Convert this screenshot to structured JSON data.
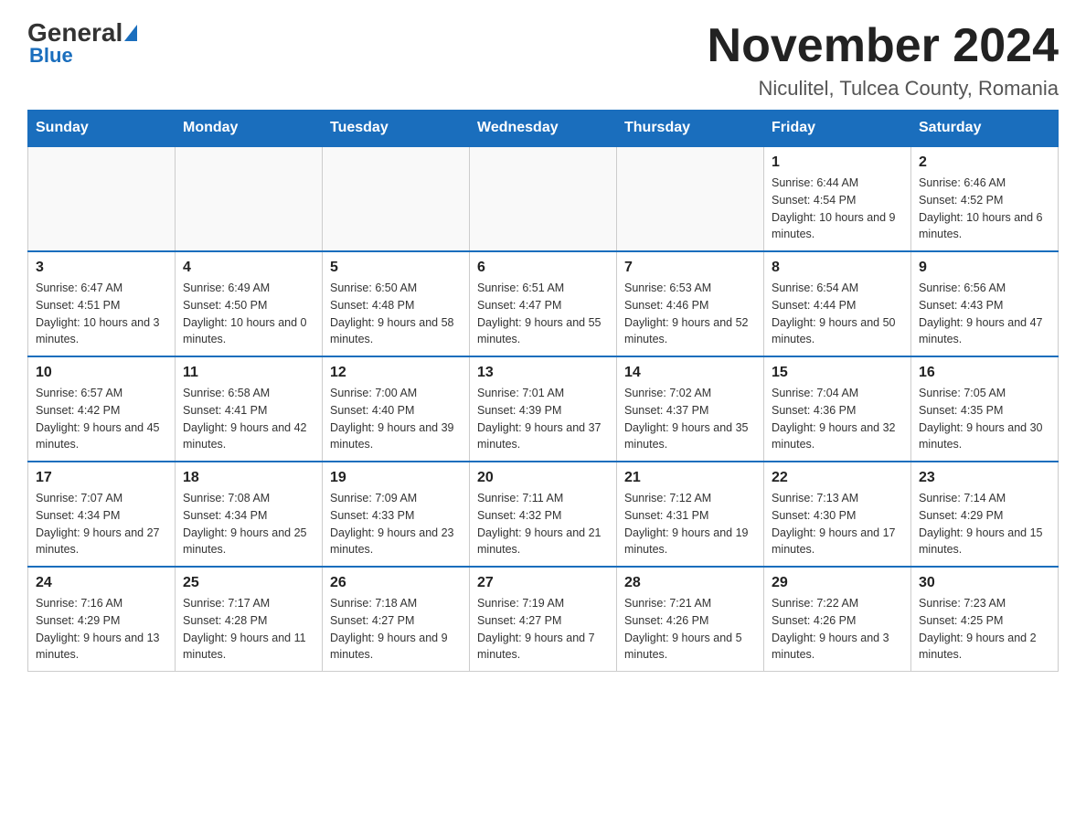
{
  "logo": {
    "general": "General",
    "blue": "Blue",
    "arrow": "▶"
  },
  "header": {
    "title": "November 2024",
    "subtitle": "Niculitel, Tulcea County, Romania"
  },
  "days_of_week": [
    "Sunday",
    "Monday",
    "Tuesday",
    "Wednesday",
    "Thursday",
    "Friday",
    "Saturday"
  ],
  "weeks": [
    [
      {
        "day": "",
        "info": ""
      },
      {
        "day": "",
        "info": ""
      },
      {
        "day": "",
        "info": ""
      },
      {
        "day": "",
        "info": ""
      },
      {
        "day": "",
        "info": ""
      },
      {
        "day": "1",
        "info": "Sunrise: 6:44 AM\nSunset: 4:54 PM\nDaylight: 10 hours and 9 minutes."
      },
      {
        "day": "2",
        "info": "Sunrise: 6:46 AM\nSunset: 4:52 PM\nDaylight: 10 hours and 6 minutes."
      }
    ],
    [
      {
        "day": "3",
        "info": "Sunrise: 6:47 AM\nSunset: 4:51 PM\nDaylight: 10 hours and 3 minutes."
      },
      {
        "day": "4",
        "info": "Sunrise: 6:49 AM\nSunset: 4:50 PM\nDaylight: 10 hours and 0 minutes."
      },
      {
        "day": "5",
        "info": "Sunrise: 6:50 AM\nSunset: 4:48 PM\nDaylight: 9 hours and 58 minutes."
      },
      {
        "day": "6",
        "info": "Sunrise: 6:51 AM\nSunset: 4:47 PM\nDaylight: 9 hours and 55 minutes."
      },
      {
        "day": "7",
        "info": "Sunrise: 6:53 AM\nSunset: 4:46 PM\nDaylight: 9 hours and 52 minutes."
      },
      {
        "day": "8",
        "info": "Sunrise: 6:54 AM\nSunset: 4:44 PM\nDaylight: 9 hours and 50 minutes."
      },
      {
        "day": "9",
        "info": "Sunrise: 6:56 AM\nSunset: 4:43 PM\nDaylight: 9 hours and 47 minutes."
      }
    ],
    [
      {
        "day": "10",
        "info": "Sunrise: 6:57 AM\nSunset: 4:42 PM\nDaylight: 9 hours and 45 minutes."
      },
      {
        "day": "11",
        "info": "Sunrise: 6:58 AM\nSunset: 4:41 PM\nDaylight: 9 hours and 42 minutes."
      },
      {
        "day": "12",
        "info": "Sunrise: 7:00 AM\nSunset: 4:40 PM\nDaylight: 9 hours and 39 minutes."
      },
      {
        "day": "13",
        "info": "Sunrise: 7:01 AM\nSunset: 4:39 PM\nDaylight: 9 hours and 37 minutes."
      },
      {
        "day": "14",
        "info": "Sunrise: 7:02 AM\nSunset: 4:37 PM\nDaylight: 9 hours and 35 minutes."
      },
      {
        "day": "15",
        "info": "Sunrise: 7:04 AM\nSunset: 4:36 PM\nDaylight: 9 hours and 32 minutes."
      },
      {
        "day": "16",
        "info": "Sunrise: 7:05 AM\nSunset: 4:35 PM\nDaylight: 9 hours and 30 minutes."
      }
    ],
    [
      {
        "day": "17",
        "info": "Sunrise: 7:07 AM\nSunset: 4:34 PM\nDaylight: 9 hours and 27 minutes."
      },
      {
        "day": "18",
        "info": "Sunrise: 7:08 AM\nSunset: 4:34 PM\nDaylight: 9 hours and 25 minutes."
      },
      {
        "day": "19",
        "info": "Sunrise: 7:09 AM\nSunset: 4:33 PM\nDaylight: 9 hours and 23 minutes."
      },
      {
        "day": "20",
        "info": "Sunrise: 7:11 AM\nSunset: 4:32 PM\nDaylight: 9 hours and 21 minutes."
      },
      {
        "day": "21",
        "info": "Sunrise: 7:12 AM\nSunset: 4:31 PM\nDaylight: 9 hours and 19 minutes."
      },
      {
        "day": "22",
        "info": "Sunrise: 7:13 AM\nSunset: 4:30 PM\nDaylight: 9 hours and 17 minutes."
      },
      {
        "day": "23",
        "info": "Sunrise: 7:14 AM\nSunset: 4:29 PM\nDaylight: 9 hours and 15 minutes."
      }
    ],
    [
      {
        "day": "24",
        "info": "Sunrise: 7:16 AM\nSunset: 4:29 PM\nDaylight: 9 hours and 13 minutes."
      },
      {
        "day": "25",
        "info": "Sunrise: 7:17 AM\nSunset: 4:28 PM\nDaylight: 9 hours and 11 minutes."
      },
      {
        "day": "26",
        "info": "Sunrise: 7:18 AM\nSunset: 4:27 PM\nDaylight: 9 hours and 9 minutes."
      },
      {
        "day": "27",
        "info": "Sunrise: 7:19 AM\nSunset: 4:27 PM\nDaylight: 9 hours and 7 minutes."
      },
      {
        "day": "28",
        "info": "Sunrise: 7:21 AM\nSunset: 4:26 PM\nDaylight: 9 hours and 5 minutes."
      },
      {
        "day": "29",
        "info": "Sunrise: 7:22 AM\nSunset: 4:26 PM\nDaylight: 9 hours and 3 minutes."
      },
      {
        "day": "30",
        "info": "Sunrise: 7:23 AM\nSunset: 4:25 PM\nDaylight: 9 hours and 2 minutes."
      }
    ]
  ]
}
